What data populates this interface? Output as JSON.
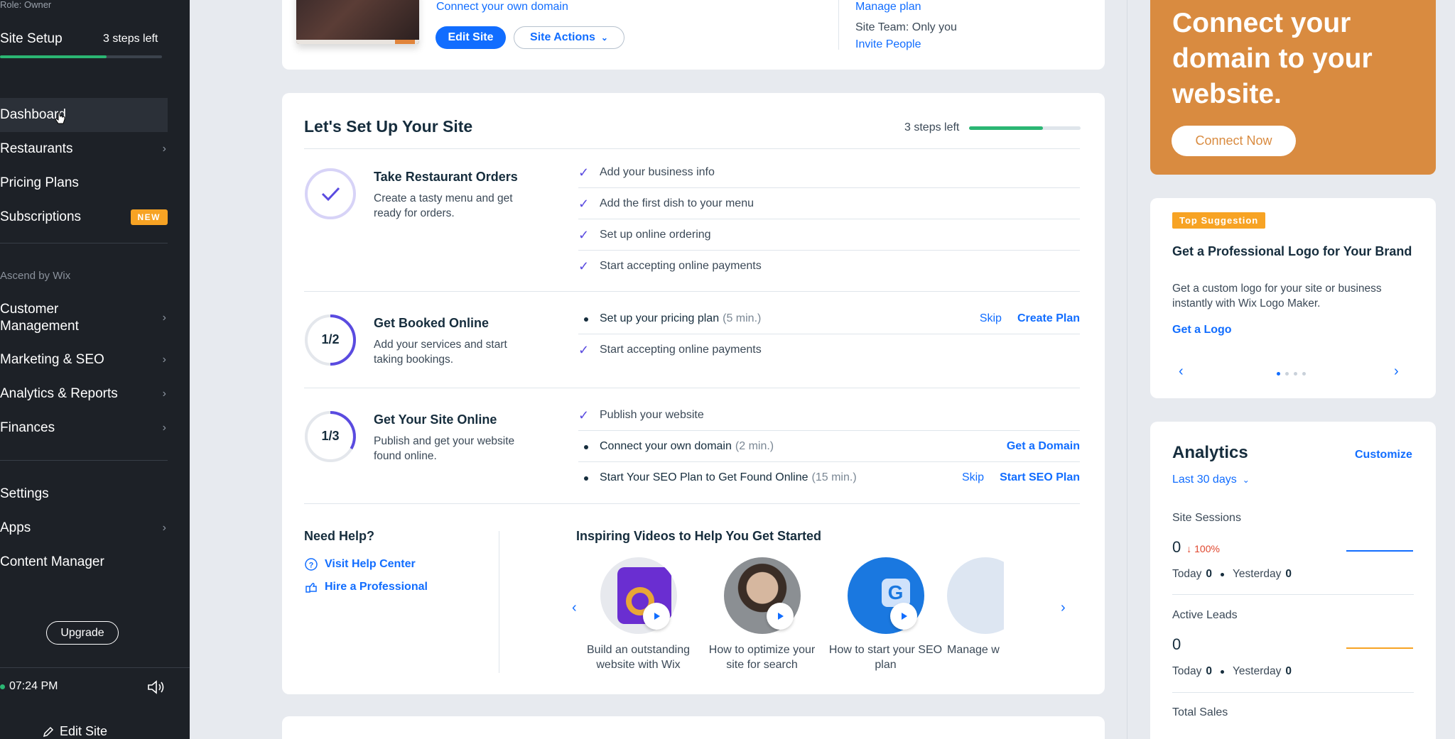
{
  "sidebar": {
    "role": "Role: Owner",
    "setup_title": "Site Setup",
    "setup_steps": "3 steps left",
    "setup_progress": 0.66,
    "items": [
      {
        "label": "Dashboard"
      },
      {
        "label": "Restaurants"
      },
      {
        "label": "Pricing Plans"
      },
      {
        "label": "Subscriptions"
      },
      {
        "label": "Customer Management"
      },
      {
        "label": "Marketing & SEO"
      },
      {
        "label": "Analytics & Reports"
      },
      {
        "label": "Finances"
      },
      {
        "label": "Settings"
      },
      {
        "label": "Apps"
      },
      {
        "label": "Content Manager"
      }
    ],
    "new_badge": "NEW",
    "section_ascend": "Ascend by Wix",
    "upgrade": "Upgrade",
    "time": "07:24 PM",
    "edit_site": "Edit Site"
  },
  "top_card": {
    "connect_domain": "Connect your own domain",
    "edit_site": "Edit Site",
    "site_actions": "Site Actions",
    "manage_plan": "Manage plan",
    "site_team": "Site Team: Only you",
    "invite_people": "Invite People"
  },
  "setup": {
    "title": "Let's Set Up Your Site",
    "steps_left": "3 steps left",
    "progress": 0.66,
    "sections": [
      {
        "title": "Take Restaurant Orders",
        "desc": "Create a tasty menu and get ready for orders.",
        "tasks": [
          {
            "text": "Add your business info"
          },
          {
            "text": "Add the first dish to your menu"
          },
          {
            "text": "Set up online ordering"
          },
          {
            "text": "Start accepting online payments"
          }
        ]
      },
      {
        "title": "Get Booked Online",
        "ring": "1/2",
        "desc": "Add your services and start taking bookings.",
        "tasks": [
          {
            "text": "Set up your pricing plan",
            "time": "(5 min.)",
            "skip": "Skip",
            "action": "Create Plan"
          },
          {
            "text": "Start accepting online payments"
          }
        ]
      },
      {
        "title": "Get Your Site Online",
        "ring": "1/3",
        "desc": "Publish and get your website found online.",
        "tasks": [
          {
            "text": "Publish your website"
          },
          {
            "text": "Connect your own domain",
            "time": "(2 min.)",
            "action": "Get a Domain"
          },
          {
            "text": "Start Your SEO Plan to Get Found Online",
            "time": "(15 min.)",
            "skip": "Skip",
            "action": "Start SEO Plan"
          }
        ]
      }
    ],
    "help": {
      "title": "Need Help?",
      "visit": "Visit Help Center",
      "hire": "Hire a Professional"
    },
    "videos": {
      "title": "Inspiring Videos to Help You Get Started",
      "items": [
        {
          "caption": "Build an outstanding website with Wix"
        },
        {
          "caption": "How to optimize your site for search"
        },
        {
          "caption": "How to start your SEO plan"
        },
        {
          "caption": "Manage w"
        }
      ]
    }
  },
  "promo": {
    "text": "Connect your domain to your website.",
    "button": "Connect Now"
  },
  "suggestion": {
    "tag": "Top Suggestion",
    "title": "Get a Professional Logo for Your Brand",
    "desc": "Get a custom logo for your site or business instantly with Wix Logo Maker.",
    "link": "Get a Logo"
  },
  "analytics": {
    "title": "Analytics",
    "customize": "Customize",
    "range": "Last 30 days",
    "metrics": [
      {
        "label": "Site Sessions",
        "value": "0",
        "change": "100%",
        "today_label": "Today",
        "today": "0",
        "yesterday_label": "Yesterday",
        "yesterday": "0",
        "color": "#116dff"
      },
      {
        "label": "Active Leads",
        "value": "0",
        "today_label": "Today",
        "today": "0",
        "yesterday_label": "Yesterday",
        "yesterday": "0",
        "color": "#f7a324"
      },
      {
        "label": "Total Sales"
      }
    ]
  },
  "colors": {
    "accent": "#116dff",
    "success": "#2bb673",
    "promo": "#d98b40",
    "sidebar": "#1d2127"
  }
}
